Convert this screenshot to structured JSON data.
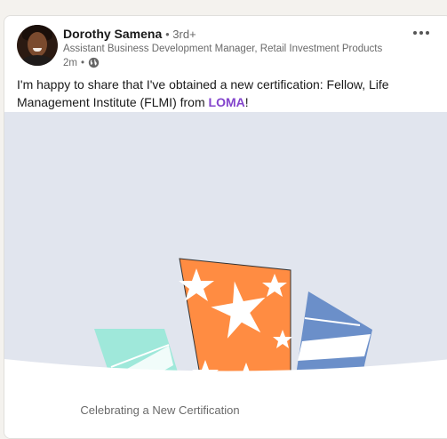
{
  "post": {
    "author_name": "Dorothy Samena",
    "connection_degree": "• 3rd+",
    "headline": "Assistant Business Development Manager, Retail Investment Products at ...",
    "time": "2m",
    "separator": "•",
    "visibility_icon": "globe-icon",
    "text_before": "I'm happy to share that I've obtained a new certification: Fellow, Life Management Institute (FLMI) from ",
    "link_text": "LOMA",
    "text_after": "!",
    "more_icon": "more-horizontal-icon"
  },
  "media": {
    "caption": "Celebrating a New Certification",
    "colors": {
      "background": "#e1e5ee",
      "orange": "#ff8c42",
      "teal": "#9fe8da",
      "blue": "#6b8fc9",
      "white": "#ffffff"
    }
  }
}
